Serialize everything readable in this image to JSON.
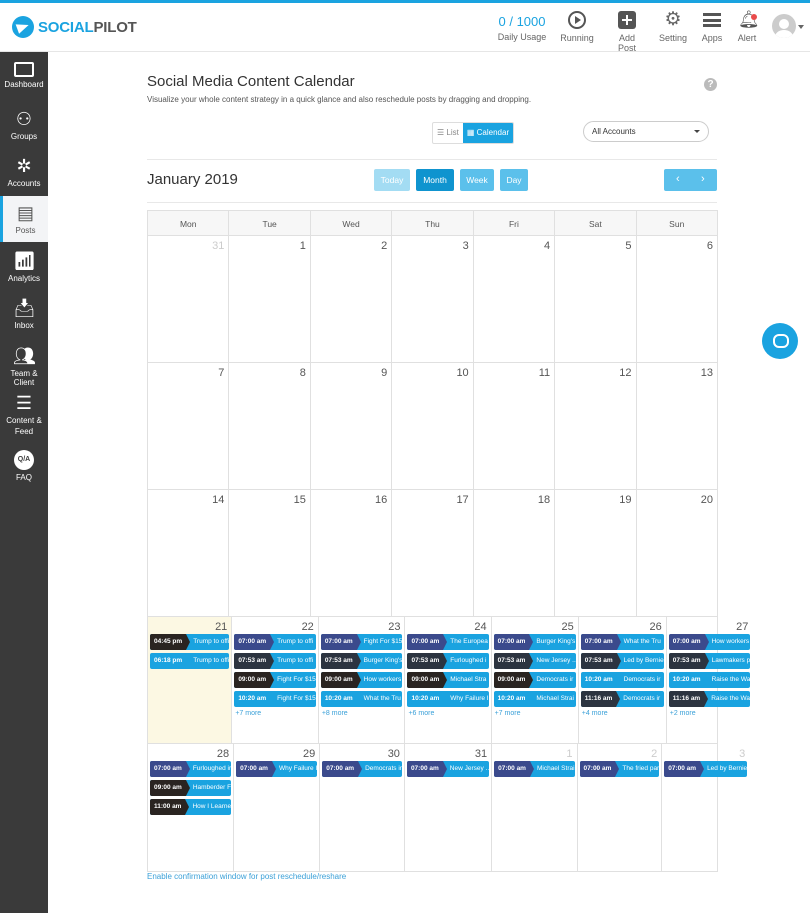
{
  "header": {
    "logo_part1": "SOCIAL",
    "logo_part2": "PILOT",
    "usage_value": "0 / 1000",
    "usage_label": "Daily Usage",
    "buttons": [
      {
        "label": "Running",
        "icon": "play-circle-icon"
      },
      {
        "label": "Add Post",
        "icon": "plus-square-icon"
      },
      {
        "label": "Setting",
        "icon": "gear-icon"
      },
      {
        "label": "Apps",
        "icon": "menu-icon"
      },
      {
        "label": "Alert",
        "icon": "bell-icon"
      }
    ]
  },
  "sidebar": {
    "items": [
      {
        "label": "Dashboard",
        "icon": "monitor-icon"
      },
      {
        "label": "Groups",
        "icon": "groups-icon"
      },
      {
        "label": "Accounts",
        "icon": "accounts-icon"
      },
      {
        "label": "Posts",
        "icon": "posts-icon",
        "active": true
      },
      {
        "label": "Analytics",
        "icon": "analytics-icon"
      },
      {
        "label": "Inbox",
        "icon": "inbox-icon"
      },
      {
        "label": "Team & Client",
        "icon": "team-icon"
      },
      {
        "label": "Content &",
        "label2": "Feed",
        "icon": "content-feed-icon"
      },
      {
        "label": "FAQ",
        "icon": "qa-icon",
        "glyph": "Q/A"
      }
    ]
  },
  "page": {
    "title": "Social Media Content Calendar",
    "subtitle": "Visualize your whole content strategy in a quick glance and also reschedule posts by dragging and dropping.",
    "view_list": "List",
    "view_calendar": "Calendar",
    "account_select": "All Accounts",
    "month_title": "January 2019",
    "btn_today": "Today",
    "btn_month": "Month",
    "btn_week": "Week",
    "btn_day": "Day",
    "prev": "‹",
    "next": "›",
    "footer_link": "Enable confirmation window for post reschedule/reshare"
  },
  "colors": {
    "accent": "#1aa3e0",
    "navy": "#3b4a8c",
    "slate": "#2c3440",
    "dark": "#2a2421",
    "today_bg": "#fcf8e3"
  },
  "calendar": {
    "weekdays": [
      "Mon",
      "Tue",
      "Wed",
      "Thu",
      "Fri",
      "Sat",
      "Sun"
    ],
    "weeks": [
      [
        {
          "d": "31",
          "o": true
        },
        {
          "d": "1"
        },
        {
          "d": "2"
        },
        {
          "d": "3"
        },
        {
          "d": "4"
        },
        {
          "d": "5"
        },
        {
          "d": "6"
        }
      ],
      [
        {
          "d": "7"
        },
        {
          "d": "8"
        },
        {
          "d": "9"
        },
        {
          "d": "10"
        },
        {
          "d": "11"
        },
        {
          "d": "12"
        },
        {
          "d": "13"
        }
      ],
      [
        {
          "d": "14"
        },
        {
          "d": "15"
        },
        {
          "d": "16"
        },
        {
          "d": "17"
        },
        {
          "d": "18"
        },
        {
          "d": "19"
        },
        {
          "d": "20"
        }
      ],
      [
        {
          "d": "21",
          "today": true,
          "events": [
            {
              "time": "04:45 pm",
              "title": "Trump to offi",
              "type": "dark"
            },
            {
              "time": "06:18 pm",
              "title": "Trump to offi",
              "type": "blue"
            }
          ]
        },
        {
          "d": "22",
          "events": [
            {
              "time": "07:00 am",
              "title": "Trump to offi",
              "type": "navy"
            },
            {
              "time": "07:53 am",
              "title": "Trump to offi",
              "type": "slate"
            },
            {
              "time": "09:00 am",
              "title": "Fight For $15",
              "type": "dark"
            },
            {
              "time": "10:20 am",
              "title": "Fight For $15",
              "type": "blue"
            }
          ],
          "more": "+7 more"
        },
        {
          "d": "23",
          "events": [
            {
              "time": "07:00 am",
              "title": "Fight For $15",
              "type": "navy"
            },
            {
              "time": "07:53 am",
              "title": "Burger King's",
              "type": "slate"
            },
            {
              "time": "09:00 am",
              "title": "How workers",
              "type": "dark"
            },
            {
              "time": "10:20 am",
              "title": "What the Tru",
              "type": "blue"
            }
          ],
          "more": "+8 more"
        },
        {
          "d": "24",
          "events": [
            {
              "time": "07:00 am",
              "title": "The Europea",
              "type": "navy"
            },
            {
              "time": "07:53 am",
              "title": "Furloughed i",
              "type": "slate"
            },
            {
              "time": "09:00 am",
              "title": "Michael Stra",
              "type": "dark"
            },
            {
              "time": "10:20 am",
              "title": "Why Failure I",
              "type": "blue"
            }
          ],
          "more": "+6 more"
        },
        {
          "d": "25",
          "events": [
            {
              "time": "07:00 am",
              "title": "Burger King's",
              "type": "navy"
            },
            {
              "time": "07:53 am",
              "title": "New Jersey ..",
              "type": "slate"
            },
            {
              "time": "09:00 am",
              "title": "Democrats ir",
              "type": "dark"
            },
            {
              "time": "10:20 am",
              "title": "Michael Strai",
              "type": "blue"
            }
          ],
          "more": "+7 more"
        },
        {
          "d": "26",
          "events": [
            {
              "time": "07:00 am",
              "title": "What the Tru",
              "type": "navy"
            },
            {
              "time": "07:53 am",
              "title": "Led by Bernie",
              "type": "slate"
            },
            {
              "time": "10:20 am",
              "title": "Democrats ir",
              "type": "blue"
            },
            {
              "time": "11:16 am",
              "title": "Democrats ir",
              "type": "slate"
            }
          ],
          "more": "+4 more"
        },
        {
          "d": "27",
          "events": [
            {
              "time": "07:00 am",
              "title": "How workers",
              "type": "navy"
            },
            {
              "time": "07:53 am",
              "title": "Lawmakers p",
              "type": "slate"
            },
            {
              "time": "10:20 am",
              "title": "Raise the Wa",
              "type": "blue"
            },
            {
              "time": "11:16 am",
              "title": "Raise the Wa",
              "type": "slate"
            }
          ],
          "more": "+2 more"
        }
      ],
      [
        {
          "d": "28",
          "events": [
            {
              "time": "07:00 am",
              "title": "Furloughed ir",
              "type": "navy"
            },
            {
              "time": "09:00 am",
              "title": "Hamberder F",
              "type": "dark"
            },
            {
              "time": "11:00 am",
              "title": "How I Learne",
              "type": "dark"
            }
          ]
        },
        {
          "d": "29",
          "events": [
            {
              "time": "07:00 am",
              "title": "Why Failure I",
              "type": "navy"
            }
          ]
        },
        {
          "d": "30",
          "events": [
            {
              "time": "07:00 am",
              "title": "Democrats ir",
              "type": "navy"
            }
          ]
        },
        {
          "d": "31",
          "events": [
            {
              "time": "07:00 am",
              "title": "New Jersey ..",
              "type": "navy"
            }
          ]
        },
        {
          "d": "1",
          "o": true,
          "events": [
            {
              "time": "07:00 am",
              "title": "Michael Strai",
              "type": "navy"
            }
          ]
        },
        {
          "d": "2",
          "o": true,
          "events": [
            {
              "time": "07:00 am",
              "title": "The fried par",
              "type": "navy"
            }
          ]
        },
        {
          "d": "3",
          "o": true,
          "events": [
            {
              "time": "07:00 am",
              "title": "Led by Bernie",
              "type": "navy"
            }
          ]
        }
      ]
    ]
  }
}
